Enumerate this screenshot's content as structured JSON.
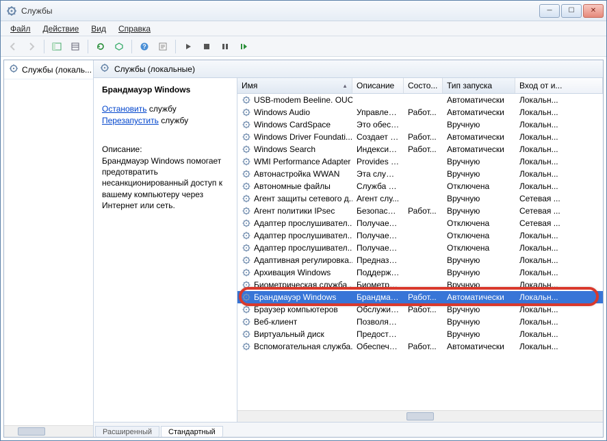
{
  "window": {
    "title": "Службы"
  },
  "menu": {
    "file": "Файл",
    "action": "Действие",
    "view": "Вид",
    "help": "Справка"
  },
  "tree": {
    "root": "Службы (локаль..."
  },
  "pane_header": "Службы (локальные)",
  "detail": {
    "title": "Брандмауэр Windows",
    "stop_link": "Остановить",
    "stop_tail": " службу",
    "restart_link": "Перезапустить",
    "restart_tail": " службу",
    "desc_label": "Описание:",
    "desc": "Брандмауэр Windows помогает предотвратить несанкционированный доступ к вашему компьютеру через Интернет или сеть."
  },
  "columns": {
    "name": "Имя",
    "desc": "Описание",
    "state": "Состо...",
    "startup": "Тип запуска",
    "logon": "Вход от и..."
  },
  "services": [
    {
      "name": "USB-modem Beeline. OUC",
      "desc": "",
      "state": "",
      "startup": "Автоматически",
      "logon": "Локальн..."
    },
    {
      "name": "Windows Audio",
      "desc": "Управлен...",
      "state": "Работ...",
      "startup": "Автоматически",
      "logon": "Локальн..."
    },
    {
      "name": "Windows CardSpace",
      "desc": "Это обесп...",
      "state": "",
      "startup": "Вручную",
      "logon": "Локальн..."
    },
    {
      "name": "Windows Driver Foundati...",
      "desc": "Создает п...",
      "state": "Работ...",
      "startup": "Автоматически",
      "logon": "Локальн..."
    },
    {
      "name": "Windows Search",
      "desc": "Индексир...",
      "state": "Работ...",
      "startup": "Автоматически",
      "logon": "Локальн..."
    },
    {
      "name": "WMI Performance Adapter",
      "desc": "Provides p...",
      "state": "",
      "startup": "Вручную",
      "logon": "Локальн..."
    },
    {
      "name": "Автонастройка WWAN",
      "desc": "Эта служб...",
      "state": "",
      "startup": "Вручную",
      "logon": "Локальн..."
    },
    {
      "name": "Автономные файлы",
      "desc": "Служба ав...",
      "state": "",
      "startup": "Отключена",
      "logon": "Локальн..."
    },
    {
      "name": "Агент защиты сетевого д...",
      "desc": "Агент слу...",
      "state": "",
      "startup": "Вручную",
      "logon": "Сетевая ..."
    },
    {
      "name": "Агент политики IPsec",
      "desc": "Безопасно...",
      "state": "Работ...",
      "startup": "Вручную",
      "logon": "Сетевая ..."
    },
    {
      "name": "Адаптер прослушивател...",
      "desc": "Получает ...",
      "state": "",
      "startup": "Отключена",
      "logon": "Сетевая ..."
    },
    {
      "name": "Адаптер прослушивател...",
      "desc": "Получает ...",
      "state": "",
      "startup": "Отключена",
      "logon": "Локальн..."
    },
    {
      "name": "Адаптер прослушивател...",
      "desc": "Получает ...",
      "state": "",
      "startup": "Отключена",
      "logon": "Локальн..."
    },
    {
      "name": "Адаптивная регулировка...",
      "desc": "Предназна...",
      "state": "",
      "startup": "Вручную",
      "logon": "Локальн..."
    },
    {
      "name": "Архивация Windows",
      "desc": "Поддержк...",
      "state": "",
      "startup": "Вручную",
      "logon": "Локальн..."
    },
    {
      "name": "Биометрическая служба ...",
      "desc": "Биометри...",
      "state": "",
      "startup": "Вручную",
      "logon": "Локальн..."
    },
    {
      "name": "Брандмауэр Windows",
      "desc": "Брандмау...",
      "state": "Работ...",
      "startup": "Автоматически",
      "logon": "Локальн...",
      "selected": true
    },
    {
      "name": "Браузер компьютеров",
      "desc": "Обслужив...",
      "state": "Работ...",
      "startup": "Вручную",
      "logon": "Локальн..."
    },
    {
      "name": "Веб-клиент",
      "desc": "Позволяет...",
      "state": "",
      "startup": "Вручную",
      "logon": "Локальн..."
    },
    {
      "name": "Виртуальный диск",
      "desc": "Предостав...",
      "state": "",
      "startup": "Вручную",
      "logon": "Локальн..."
    },
    {
      "name": "Вспомогательная служба...",
      "desc": "Обеспечи...",
      "state": "Работ...",
      "startup": "Автоматически",
      "logon": "Локальн..."
    }
  ],
  "tabs": {
    "extended": "Расширенный",
    "standard": "Стандартный"
  },
  "highlight_row_index": 16
}
